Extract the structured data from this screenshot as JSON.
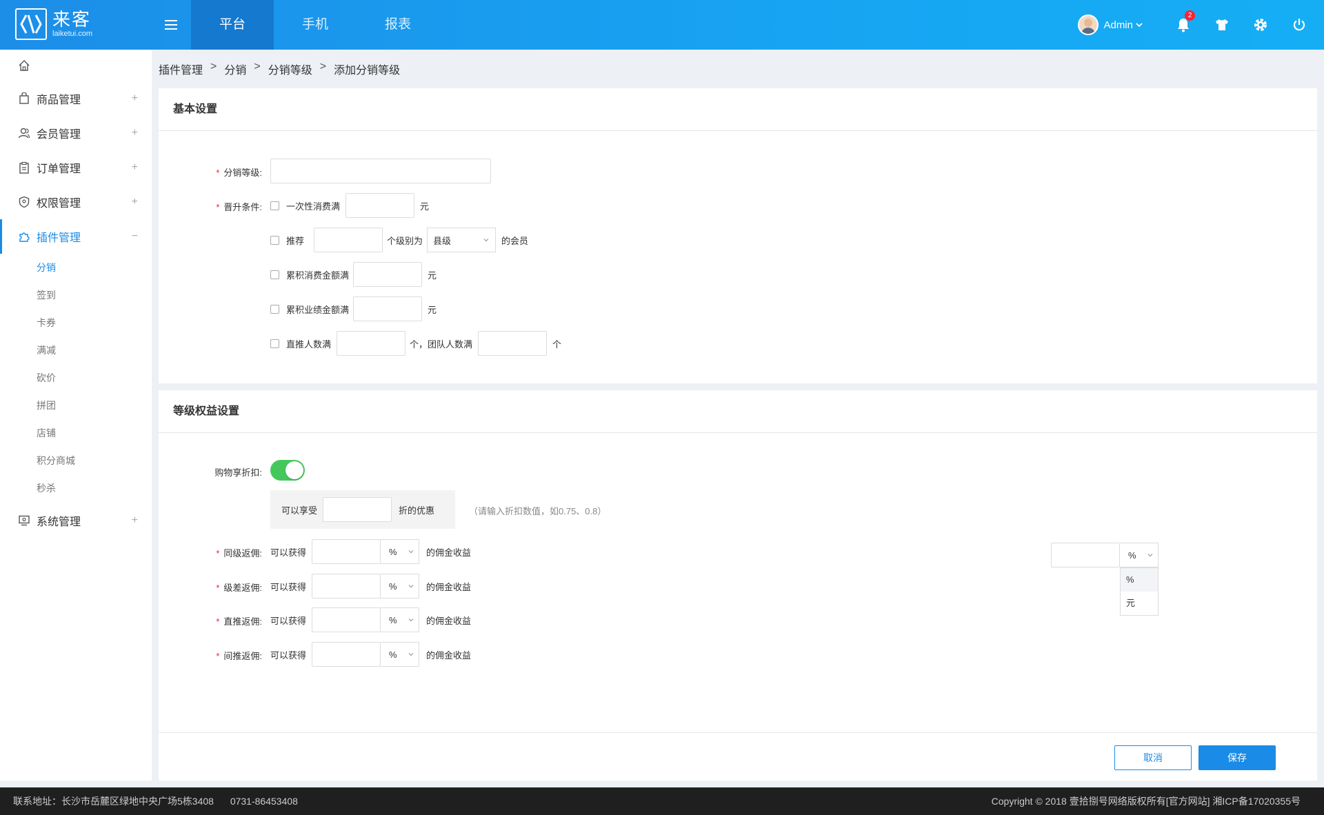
{
  "header": {
    "logo_name": "来客",
    "logo_sub": "laiketui.com",
    "tabs": [
      "平台",
      "手机",
      "报表"
    ],
    "user_name": "Admin",
    "notification_count": "2"
  },
  "sidebar": {
    "items": [
      {
        "label": "商品管理"
      },
      {
        "label": "会员管理"
      },
      {
        "label": "订单管理"
      },
      {
        "label": "权限管理"
      },
      {
        "label": "插件管理"
      },
      {
        "label": "系统管理"
      }
    ],
    "plugin_subitems": [
      "分销",
      "签到",
      "卡券",
      "满减",
      "砍价",
      "拼团",
      "店铺",
      "积分商城",
      "秒杀"
    ]
  },
  "breadcrumb": [
    "插件管理",
    "分销",
    "分销等级",
    "添加分销等级"
  ],
  "basic": {
    "title": "基本设置",
    "level_label": "分销等级:",
    "level_value": "",
    "promote_label": "晋升条件:",
    "cond1_label": "一次性消费满",
    "cond1_unit": "元",
    "cond2_label": "推荐",
    "cond2_mid": "个级别为",
    "cond2_select": "县级",
    "cond2_suffix": "的会员",
    "cond3_label": "累积消费金额满",
    "cond3_unit": "元",
    "cond4_label": "累积业绩金额满",
    "cond4_unit": "元",
    "cond5_label": "直推人数满",
    "cond5_mid": "个，团队人数满",
    "cond5_unit": "个"
  },
  "rights": {
    "title": "等级权益设置",
    "discount_label": "购物享折扣:",
    "discount_on": true,
    "discount_prefix": "可以享受",
    "discount_suffix": "折的优惠",
    "discount_hint": "（请输入折扣数值，如0.75、0.8）",
    "rows": [
      {
        "label": "同级返佣:",
        "prefix": "可以获得",
        "unit": "%",
        "suffix": "的佣金收益"
      },
      {
        "label": "级差返佣:",
        "prefix": "可以获得",
        "unit": "%",
        "suffix": "的佣金收益"
      },
      {
        "label": "直推返佣:",
        "prefix": "可以获得",
        "unit": "%",
        "suffix": "的佣金收益"
      },
      {
        "label": "间推返佣:",
        "prefix": "可以获得",
        "unit": "%",
        "suffix": "的佣金收益"
      }
    ],
    "dropdown_selected": "%",
    "dropdown_options": [
      "%",
      "元"
    ]
  },
  "actions": {
    "cancel": "取消",
    "save": "保存"
  },
  "footer": {
    "address": "联系地址：长沙市岳麓区绿地中央广场5栋3408",
    "phone": "0731-86453408",
    "copyright": "Copyright © 2018 壹拾捌号网络版权所有[官方网站]  湘ICP备17020355号"
  },
  "colors": {
    "primary": "#1a8be6",
    "toggle_on": "#44c85c",
    "required": "#ee2233"
  }
}
